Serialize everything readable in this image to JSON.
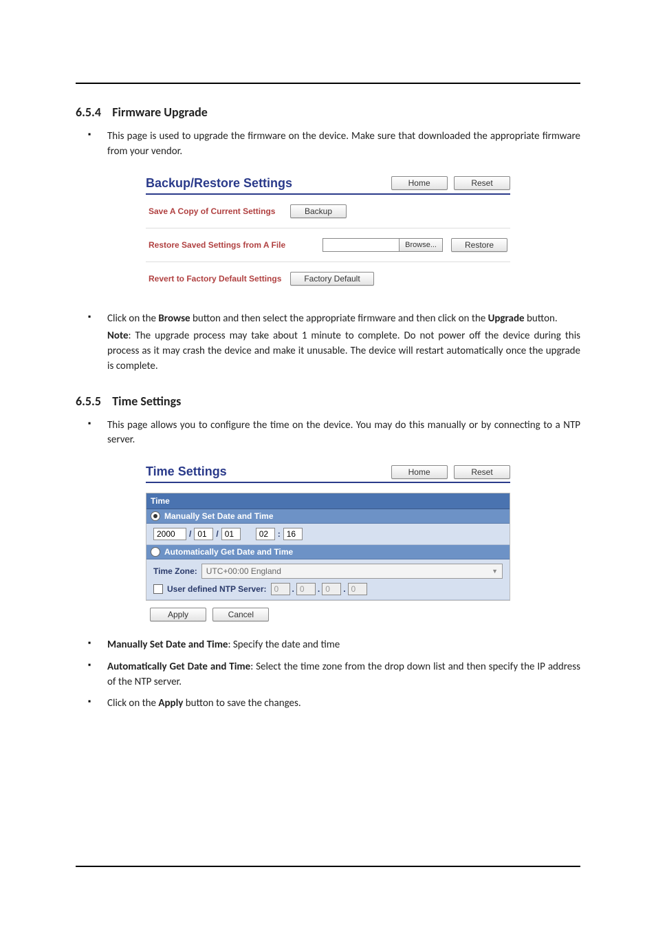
{
  "sections": {
    "s1": {
      "number": "6.5.4",
      "title": "Firmware Upgrade"
    },
    "s2": {
      "number": "6.5.5",
      "title": "Time Settings"
    }
  },
  "text": {
    "s1_intro": "This page is used to upgrade the firmware on the device. Make sure that downloaded the appropriate firmware from your vendor.",
    "s1_click_a": "Click on the ",
    "s1_click_browse": "Browse",
    "s1_click_b": " button and then select the appropriate firmware and then click on the ",
    "s1_click_upgrade": "Upgrade",
    "s1_click_c": " button.",
    "s1_note_label": "Note",
    "s1_note_body": ": The upgrade process may take about 1 minute to complete. Do not power off the device during this process as it may crash the device and make it unusable. The device will restart automatically once the upgrade is complete.",
    "s2_intro": "This page allows you to configure the time on the device. You may do this manually or by connecting to a NTP server.",
    "s2_b1_label": "Manually Set Date and Time",
    "s2_b1_body": ": Specify the date and time",
    "s2_b2_label": "Automatically Get Date and Time",
    "s2_b2_body": ": Select the time zone from the drop down list and then specify the IP address of the NTP server.",
    "s2_b3_a": "Click on the ",
    "s2_b3_apply": "Apply",
    "s2_b3_b": " button to save the changes."
  },
  "fig1": {
    "title": "Backup/Restore Settings",
    "home": "Home",
    "reset": "Reset",
    "row1_label": "Save A Copy of Current Settings",
    "row1_btn": "Backup",
    "row2_label": "Restore Saved Settings from A File",
    "row2_browse": "Browse...",
    "row2_restore": "Restore",
    "row3_label": "Revert to Factory Default Settings",
    "row3_btn": "Factory Default"
  },
  "fig2": {
    "title": "Time Settings",
    "home": "Home",
    "reset": "Reset",
    "panel_title": "Time",
    "manual_label": "Manually Set Date and Time",
    "year": "2000",
    "mon": "01",
    "day": "01",
    "hour": "02",
    "min": "16",
    "auto_label": "Automatically Get Date and Time",
    "tz_label": "Time Zone:",
    "tz_value": "UTC+00:00 England",
    "ntp_label": "User defined NTP Server:",
    "ntp1": "0",
    "ntp2": "0",
    "ntp3": "0",
    "ntp4": "0",
    "apply": "Apply",
    "cancel": "Cancel"
  }
}
